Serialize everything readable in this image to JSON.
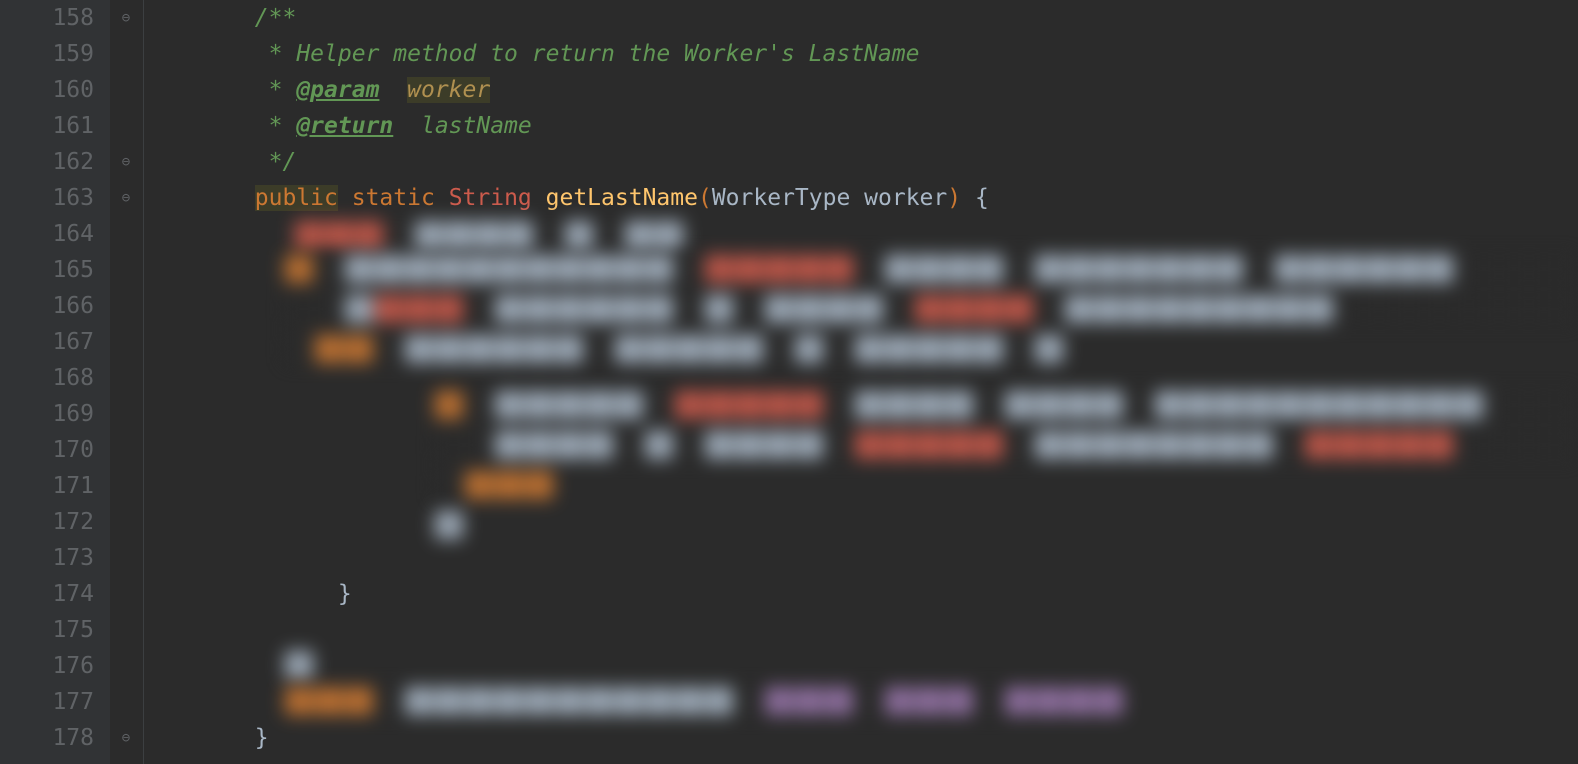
{
  "gutter": {
    "start": 158,
    "end": 178
  },
  "fold_markers": [
    {
      "line": 158,
      "glyph": "⊖"
    },
    {
      "line": 162,
      "glyph": "⊖"
    },
    {
      "line": 163,
      "glyph": "⊖"
    },
    {
      "line": 178,
      "glyph": "⊖"
    }
  ],
  "code": {
    "l158": {
      "indent": "        ",
      "text": "/**"
    },
    "l159": {
      "indent": "         ",
      "star": "* ",
      "text": "Helper method to return the Worker's LastName"
    },
    "l160": {
      "indent": "         ",
      "star": "* ",
      "tag": "@param",
      "sep": "  ",
      "param": "worker"
    },
    "l161": {
      "indent": "         ",
      "star": "* ",
      "tag": "@return",
      "sep": "  ",
      "param": "lastName"
    },
    "l162": {
      "indent": "         ",
      "text": "*/"
    },
    "l163": {
      "indent": "        ",
      "kw_public": "public",
      "sp1": " ",
      "kw_static": "static",
      "sp2": " ",
      "type_string": "String",
      "sp3": " ",
      "method": "getLastName",
      "lparen": "(",
      "param_type": "WorkerType",
      "sp4": " ",
      "param_name": "worker",
      "rparen": ")",
      "sp5": " ",
      "brace": "{"
    },
    "l174": {
      "indent": "              ",
      "brace": "}"
    },
    "l178": {
      "indent": "        ",
      "brace": "}"
    }
  }
}
